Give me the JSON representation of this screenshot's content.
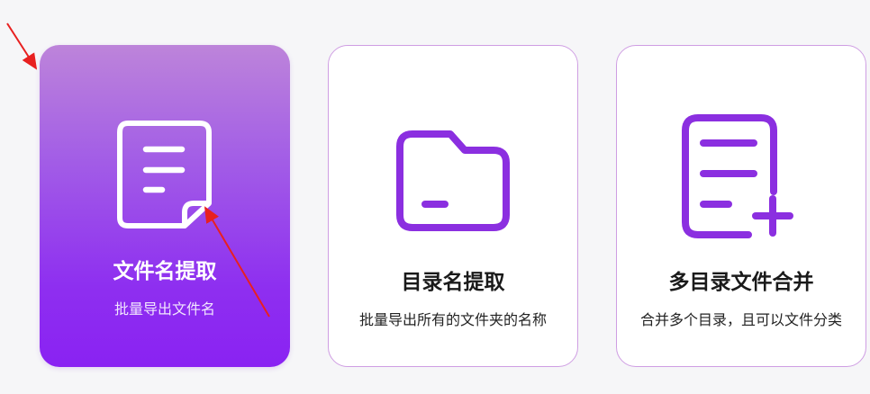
{
  "accent_color": "#8a2be2",
  "cards": [
    {
      "title": "文件名提取",
      "subtitle": "批量导出文件名",
      "icon": "document-icon",
      "selected": true
    },
    {
      "title": "目录名提取",
      "subtitle": "批量导出所有的文件夹的名称",
      "icon": "folder-icon",
      "selected": false
    },
    {
      "title": "多目录文件合并",
      "subtitle": "合并多个目录，且可以文件分类",
      "icon": "list-add-icon",
      "selected": false
    }
  ]
}
